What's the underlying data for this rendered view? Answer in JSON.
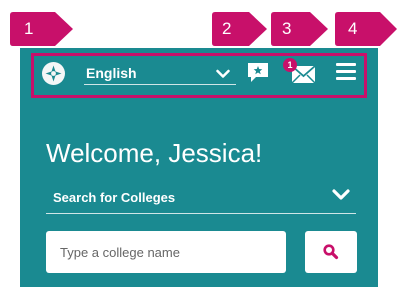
{
  "colors": {
    "panel": "#1a8a91",
    "accent": "#c8106a",
    "white": "#ffffff"
  },
  "header": {
    "language_label": "English",
    "mail_badge": "1",
    "icons": [
      "globe-icon",
      "chat-icon",
      "mail-icon",
      "hamburger-menu-icon"
    ]
  },
  "main": {
    "welcome": "Welcome, Jessica!",
    "search_toggle_label": "Search for Colleges",
    "search_placeholder": "Type a college name"
  },
  "callouts": [
    "1",
    "2",
    "3",
    "4"
  ]
}
